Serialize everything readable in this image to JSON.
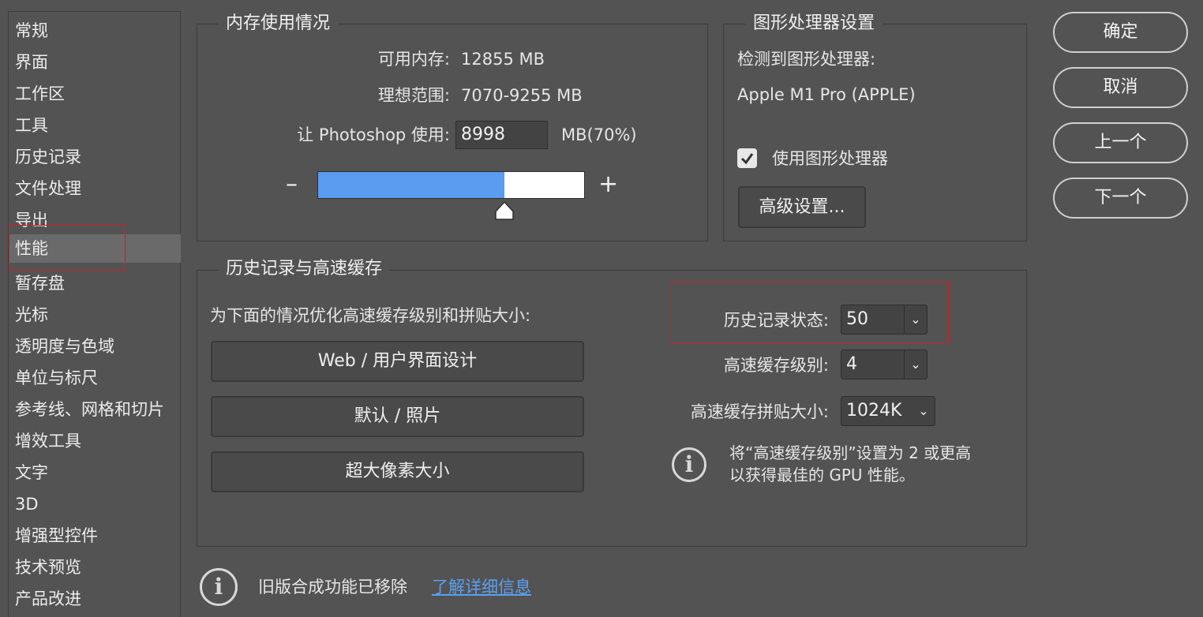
{
  "sidebar": {
    "items": [
      {
        "label": "常规"
      },
      {
        "label": "界面"
      },
      {
        "label": "工作区"
      },
      {
        "label": "工具"
      },
      {
        "label": "历史记录"
      },
      {
        "label": "文件处理"
      },
      {
        "label": "导出"
      },
      {
        "label": "性能"
      },
      {
        "label": "暂存盘"
      },
      {
        "label": "光标"
      },
      {
        "label": "透明度与色域"
      },
      {
        "label": "单位与标尺"
      },
      {
        "label": "参考线、网格和切片"
      },
      {
        "label": "增效工具"
      },
      {
        "label": "文字"
      },
      {
        "label": "3D"
      },
      {
        "label": "增强型控件"
      },
      {
        "label": "技术预览"
      },
      {
        "label": "产品改进"
      }
    ],
    "selected": "性能"
  },
  "memory": {
    "title": "内存使用情况",
    "available_label": "可用内存:",
    "available_value": "12855 MB",
    "ideal_label": "理想范围:",
    "ideal_value": "7070-9255 MB",
    "let_use_label": "让 Photoshop 使用:",
    "let_use_value": "8998",
    "percent_label": "MB(70%)",
    "minus": "–",
    "plus": "+",
    "slider_fraction": 0.7
  },
  "gpu": {
    "title": "图形处理器设置",
    "detected_label": "检测到图形处理器:",
    "gpu_name": "Apple M1 Pro (APPLE)",
    "use_gpu_label": "使用图形处理器",
    "use_gpu_checked": true,
    "advanced_button": "高级设置..."
  },
  "history_cache": {
    "title": "历史记录与高速缓存",
    "optimize_label": "为下面的情况优化高速缓存级别和拼贴大小:",
    "presets": [
      "Web / 用户界面设计",
      "默认 / 照片",
      "超大像素大小"
    ],
    "history_states_label": "历史记录状态:",
    "history_states_value": "50",
    "cache_levels_label": "高速缓存级别:",
    "cache_levels_value": "4",
    "tile_size_label": "高速缓存拼贴大小:",
    "tile_size_value": "1024K",
    "tip_line1": "将“高速缓存级别”设置为 2 或更高",
    "tip_line2": "以获得最佳的 GPU 性能。"
  },
  "footer": {
    "legacy_text": "旧版合成功能已移除",
    "learn_more": "了解详细信息"
  },
  "buttons": {
    "ok": "确定",
    "cancel": "取消",
    "prev": "上一个",
    "next": "下一个"
  },
  "colors": {
    "background": "#535353",
    "slider_fill": "#5b9bf0",
    "link": "#5aa0f2",
    "highlight": "#d21f24"
  }
}
